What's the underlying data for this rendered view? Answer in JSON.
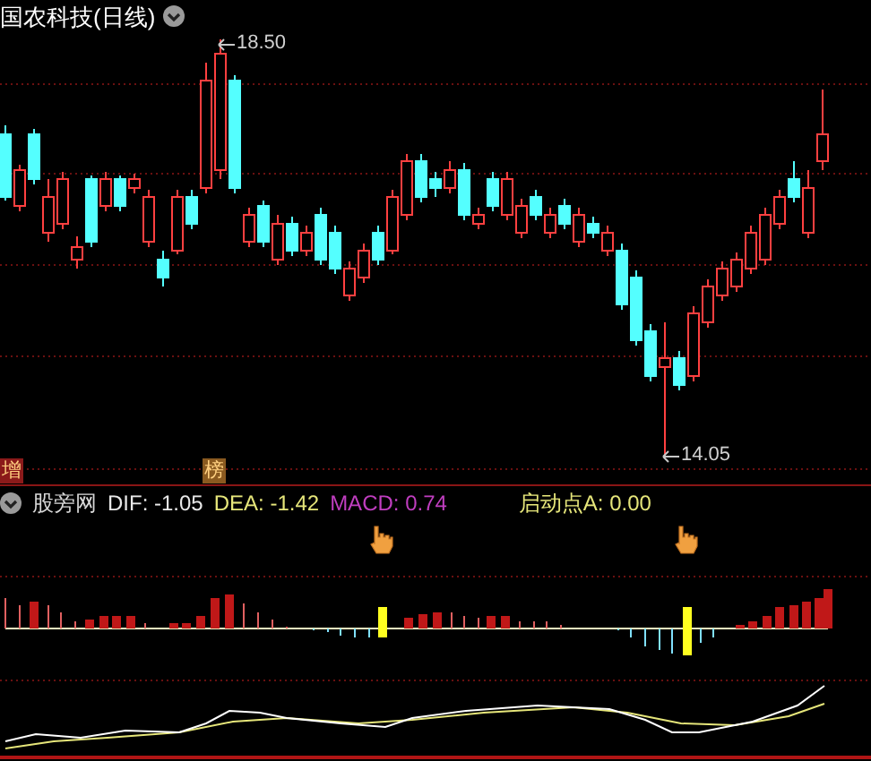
{
  "title": "国农科技(日线)",
  "price_labels": [
    {
      "kind": "high",
      "text": "18.50"
    },
    {
      "kind": "low",
      "text": "14.05"
    }
  ],
  "event_markers": [
    {
      "text": "增",
      "color": "#8b1a1a"
    },
    {
      "text": "榜",
      "color": "#8a5a20"
    }
  ],
  "indicator": {
    "name": "股旁网",
    "values": [
      {
        "label": "DIF: -1.05",
        "color": "#e8e8e8"
      },
      {
        "label": "DEA: -1.42",
        "color": "#e6e67a"
      },
      {
        "label": "MACD: 0.74",
        "color": "#c03ec0"
      },
      {
        "label": "启动点A: 0.00",
        "color": "#e6e67a"
      }
    ]
  }
}
